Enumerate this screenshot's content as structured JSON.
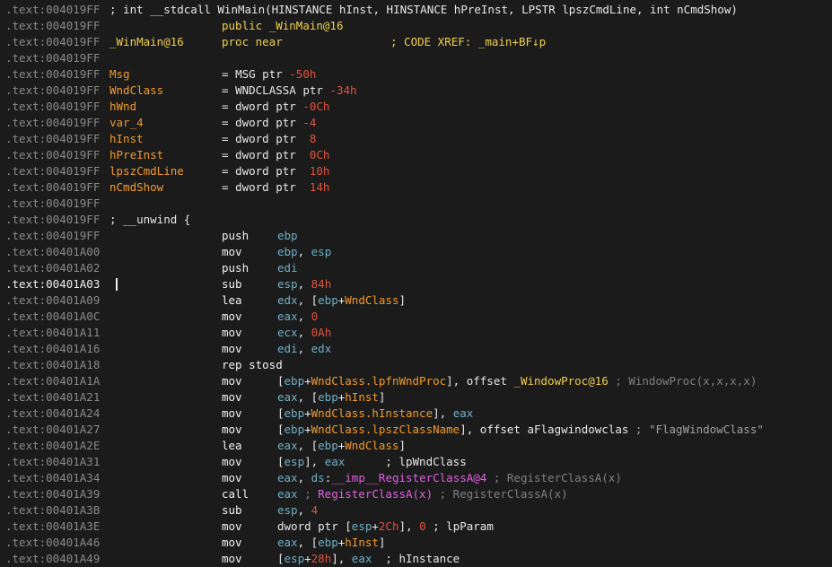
{
  "colors": {
    "background": "#1b1b1b",
    "address": "#8a8a8a",
    "label": "#f29a2e",
    "register": "#6fb0c8",
    "number": "#e0543c",
    "function": "#f0d050",
    "import": "#e060e0",
    "comment": "#808080"
  },
  "view": {
    "active_line_index": 17
  },
  "lines": [
    {
      "addr": ".text:004019FF",
      "kind": "comment",
      "text": "; int __stdcall WinMain(HINSTANCE hInst, HINSTANCE hPreInst, LPSTR lpszCmdLine, int nCmdShow)"
    },
    {
      "addr": ".text:004019FF",
      "kind": "public",
      "directive": "public",
      "name": "_WinMain@16"
    },
    {
      "addr": ".text:004019FF",
      "kind": "proc",
      "label": "_WinMain@16",
      "directive": "proc near",
      "xref": "; CODE XREF: _main+BF↓p"
    },
    {
      "addr": ".text:004019FF",
      "kind": "blank"
    },
    {
      "addr": ".text:004019FF",
      "kind": "var",
      "name": "Msg",
      "eq": "= ",
      "type": "MSG ptr ",
      "off": "-50h"
    },
    {
      "addr": ".text:004019FF",
      "kind": "var",
      "name": "WndClass",
      "eq": "= ",
      "type": "WNDCLASSA ptr ",
      "off": "-34h"
    },
    {
      "addr": ".text:004019FF",
      "kind": "var",
      "name": "hWnd",
      "eq": "= ",
      "type": "dword ptr ",
      "off": "-0Ch"
    },
    {
      "addr": ".text:004019FF",
      "kind": "var",
      "name": "var_4",
      "eq": "= ",
      "type": "dword ptr ",
      "off": "-4"
    },
    {
      "addr": ".text:004019FF",
      "kind": "var",
      "name": "hInst",
      "eq": "= ",
      "type": "dword ptr ",
      "off": " 8"
    },
    {
      "addr": ".text:004019FF",
      "kind": "var",
      "name": "hPreInst",
      "eq": "= ",
      "type": "dword ptr ",
      "off": " 0Ch"
    },
    {
      "addr": ".text:004019FF",
      "kind": "var",
      "name": "lpszCmdLine",
      "eq": "= ",
      "type": "dword ptr ",
      "off": " 10h"
    },
    {
      "addr": ".text:004019FF",
      "kind": "var",
      "name": "nCmdShow",
      "eq": "= ",
      "type": "dword ptr ",
      "off": " 14h"
    },
    {
      "addr": ".text:004019FF",
      "kind": "blank"
    },
    {
      "addr": ".text:004019FF",
      "kind": "comment",
      "text": "; __unwind {"
    },
    {
      "addr": ".text:004019FF",
      "kind": "instr",
      "mnemonic": "push",
      "operands": [
        {
          "t": "ebp",
          "c": "reg"
        }
      ]
    },
    {
      "addr": ".text:00401A00",
      "kind": "instr",
      "mnemonic": "mov",
      "operands": [
        {
          "t": "ebp",
          "c": "reg"
        },
        {
          "t": ", "
        },
        {
          "t": "esp",
          "c": "reg"
        }
      ]
    },
    {
      "addr": ".text:00401A02",
      "kind": "instr",
      "mnemonic": "push",
      "operands": [
        {
          "t": "edi",
          "c": "reg"
        }
      ]
    },
    {
      "addr": ".text:00401A03",
      "kind": "instr",
      "mnemonic": "sub",
      "operands": [
        {
          "t": "esp",
          "c": "reg"
        },
        {
          "t": ", "
        },
        {
          "t": "84h",
          "c": "num"
        }
      ]
    },
    {
      "addr": ".text:00401A09",
      "kind": "instr",
      "mnemonic": "lea",
      "operands": [
        {
          "t": "edx",
          "c": "reg"
        },
        {
          "t": ", ["
        },
        {
          "t": "ebp",
          "c": "reg"
        },
        {
          "t": "+"
        },
        {
          "t": "WndClass",
          "c": "mem"
        },
        {
          "t": "]"
        }
      ]
    },
    {
      "addr": ".text:00401A0C",
      "kind": "instr",
      "mnemonic": "mov",
      "operands": [
        {
          "t": "eax",
          "c": "reg"
        },
        {
          "t": ", "
        },
        {
          "t": "0",
          "c": "num"
        }
      ]
    },
    {
      "addr": ".text:00401A11",
      "kind": "instr",
      "mnemonic": "mov",
      "operands": [
        {
          "t": "ecx",
          "c": "reg"
        },
        {
          "t": ", "
        },
        {
          "t": "0Ah",
          "c": "num"
        }
      ]
    },
    {
      "addr": ".text:00401A16",
      "kind": "instr",
      "mnemonic": "mov",
      "operands": [
        {
          "t": "edi",
          "c": "reg"
        },
        {
          "t": ", "
        },
        {
          "t": "edx",
          "c": "reg"
        }
      ]
    },
    {
      "addr": ".text:00401A18",
      "kind": "instr",
      "mnemonic": "rep stosd",
      "operands": []
    },
    {
      "addr": ".text:00401A1A",
      "kind": "instr",
      "mnemonic": "mov",
      "operands": [
        {
          "t": "["
        },
        {
          "t": "ebp",
          "c": "reg"
        },
        {
          "t": "+"
        },
        {
          "t": "WndClass.lpfnWndProc",
          "c": "mem"
        },
        {
          "t": "], offset "
        },
        {
          "t": "_WindowProc@16",
          "c": "fn"
        },
        {
          "t": " ; WindowProc(x,x,x,x)",
          "c": "gray"
        }
      ]
    },
    {
      "addr": ".text:00401A21",
      "kind": "instr",
      "mnemonic": "mov",
      "operands": [
        {
          "t": "eax",
          "c": "reg"
        },
        {
          "t": ", ["
        },
        {
          "t": "ebp",
          "c": "reg"
        },
        {
          "t": "+"
        },
        {
          "t": "hInst",
          "c": "mem"
        },
        {
          "t": "]"
        }
      ]
    },
    {
      "addr": ".text:00401A24",
      "kind": "instr",
      "mnemonic": "mov",
      "operands": [
        {
          "t": "["
        },
        {
          "t": "ebp",
          "c": "reg"
        },
        {
          "t": "+"
        },
        {
          "t": "WndClass.hInstance",
          "c": "mem"
        },
        {
          "t": "], "
        },
        {
          "t": "eax",
          "c": "reg"
        }
      ]
    },
    {
      "addr": ".text:00401A27",
      "kind": "instr",
      "mnemonic": "mov",
      "operands": [
        {
          "t": "["
        },
        {
          "t": "ebp",
          "c": "reg"
        },
        {
          "t": "+"
        },
        {
          "t": "WndClass.lpszClassName",
          "c": "mem"
        },
        {
          "t": "], offset "
        },
        {
          "t": "aFlagwindowclas"
        },
        {
          "t": " ; \"FlagWindowClass\"",
          "c": "str"
        }
      ]
    },
    {
      "addr": ".text:00401A2E",
      "kind": "instr",
      "mnemonic": "lea",
      "operands": [
        {
          "t": "eax",
          "c": "reg"
        },
        {
          "t": ", ["
        },
        {
          "t": "ebp",
          "c": "reg"
        },
        {
          "t": "+"
        },
        {
          "t": "WndClass",
          "c": "mem"
        },
        {
          "t": "]"
        }
      ]
    },
    {
      "addr": ".text:00401A31",
      "kind": "instr",
      "mnemonic": "mov",
      "operands": [
        {
          "t": "["
        },
        {
          "t": "esp",
          "c": "reg"
        },
        {
          "t": "], "
        },
        {
          "t": "eax",
          "c": "reg"
        },
        {
          "t": "      ; lpWndClass"
        }
      ]
    },
    {
      "addr": ".text:00401A34",
      "kind": "instr",
      "mnemonic": "mov",
      "operands": [
        {
          "t": "eax",
          "c": "reg"
        },
        {
          "t": ", "
        },
        {
          "t": "ds",
          "c": "reg"
        },
        {
          "t": ":"
        },
        {
          "t": "__imp__RegisterClassA@4",
          "c": "imp"
        },
        {
          "t": " ; RegisterClassA(x)",
          "c": "gray"
        }
      ]
    },
    {
      "addr": ".text:00401A39",
      "kind": "instr",
      "mnemonic": "call",
      "operands": [
        {
          "t": "eax",
          "c": "reg"
        },
        {
          "t": " ; ",
          "c": "gray"
        },
        {
          "t": "RegisterClassA(x)",
          "c": "imp"
        },
        {
          "t": " ; RegisterClassA(x)",
          "c": "gray"
        }
      ]
    },
    {
      "addr": ".text:00401A3B",
      "kind": "instr",
      "mnemonic": "sub",
      "operands": [
        {
          "t": "esp",
          "c": "reg"
        },
        {
          "t": ", "
        },
        {
          "t": "4",
          "c": "num"
        }
      ]
    },
    {
      "addr": ".text:00401A3E",
      "kind": "instr",
      "mnemonic": "mov",
      "operands": [
        {
          "t": "dword ptr ["
        },
        {
          "t": "esp",
          "c": "reg"
        },
        {
          "t": "+"
        },
        {
          "t": "2Ch",
          "c": "num"
        },
        {
          "t": "], "
        },
        {
          "t": "0",
          "c": "num"
        },
        {
          "t": " ; lpParam"
        }
      ]
    },
    {
      "addr": ".text:00401A46",
      "kind": "instr",
      "mnemonic": "mov",
      "operands": [
        {
          "t": "eax",
          "c": "reg"
        },
        {
          "t": ", ["
        },
        {
          "t": "ebp",
          "c": "reg"
        },
        {
          "t": "+"
        },
        {
          "t": "hInst",
          "c": "mem"
        },
        {
          "t": "]"
        }
      ]
    },
    {
      "addr": ".text:00401A49",
      "kind": "instr",
      "mnemonic": "mov",
      "operands": [
        {
          "t": "["
        },
        {
          "t": "esp",
          "c": "reg"
        },
        {
          "t": "+"
        },
        {
          "t": "28h",
          "c": "num"
        },
        {
          "t": "], "
        },
        {
          "t": "eax",
          "c": "reg"
        },
        {
          "t": "  ; hInstance"
        }
      ]
    }
  ]
}
